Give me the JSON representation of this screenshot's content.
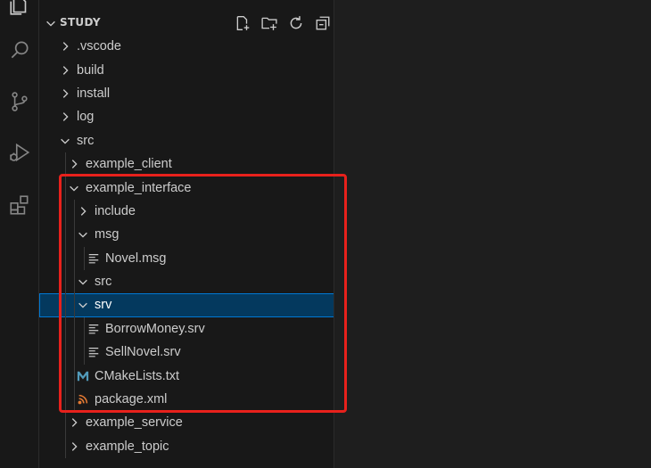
{
  "activity_bar": {
    "icons": [
      "explorer-icon",
      "search-icon",
      "source-control-icon",
      "run-debug-icon",
      "extensions-icon"
    ]
  },
  "explorer": {
    "title": "STUDY",
    "actions": [
      "new-file-icon",
      "new-folder-icon",
      "refresh-icon",
      "collapse-all-icon"
    ]
  },
  "tree": [
    {
      "label": ".vscode",
      "type": "folder",
      "expanded": false,
      "depth": 0
    },
    {
      "label": "build",
      "type": "folder",
      "expanded": false,
      "depth": 0
    },
    {
      "label": "install",
      "type": "folder",
      "expanded": false,
      "depth": 0
    },
    {
      "label": "log",
      "type": "folder",
      "expanded": false,
      "depth": 0
    },
    {
      "label": "src",
      "type": "folder",
      "expanded": true,
      "depth": 0
    },
    {
      "label": "example_client",
      "type": "folder",
      "expanded": false,
      "depth": 1
    },
    {
      "label": "example_interface",
      "type": "folder",
      "expanded": true,
      "depth": 1
    },
    {
      "label": "include",
      "type": "folder",
      "expanded": false,
      "depth": 2
    },
    {
      "label": "msg",
      "type": "folder",
      "expanded": true,
      "depth": 2
    },
    {
      "label": "Novel.msg",
      "type": "file",
      "icon": "lines",
      "depth": 3
    },
    {
      "label": "src",
      "type": "folder",
      "expanded": true,
      "depth": 2
    },
    {
      "label": "srv",
      "type": "folder",
      "expanded": true,
      "depth": 2,
      "selected": true
    },
    {
      "label": "BorrowMoney.srv",
      "type": "file",
      "icon": "lines",
      "depth": 3
    },
    {
      "label": "SellNovel.srv",
      "type": "file",
      "icon": "lines",
      "depth": 3
    },
    {
      "label": "CMakeLists.txt",
      "type": "file",
      "icon": "cmake",
      "depth": 2
    },
    {
      "label": "package.xml",
      "type": "file",
      "icon": "rss",
      "depth": 2
    },
    {
      "label": "example_service",
      "type": "folder",
      "expanded": false,
      "depth": 1
    },
    {
      "label": "example_topic",
      "type": "folder",
      "expanded": false,
      "depth": 1
    }
  ],
  "colors": {
    "background": "#1e1e1e",
    "sidebar": "#181818",
    "text": "#cccccc",
    "selection": "#04395e",
    "selection_border": "#0078d4",
    "annotation": "#e8211c",
    "cmake_icon": "#519aba",
    "rss_icon": "#e37933"
  }
}
